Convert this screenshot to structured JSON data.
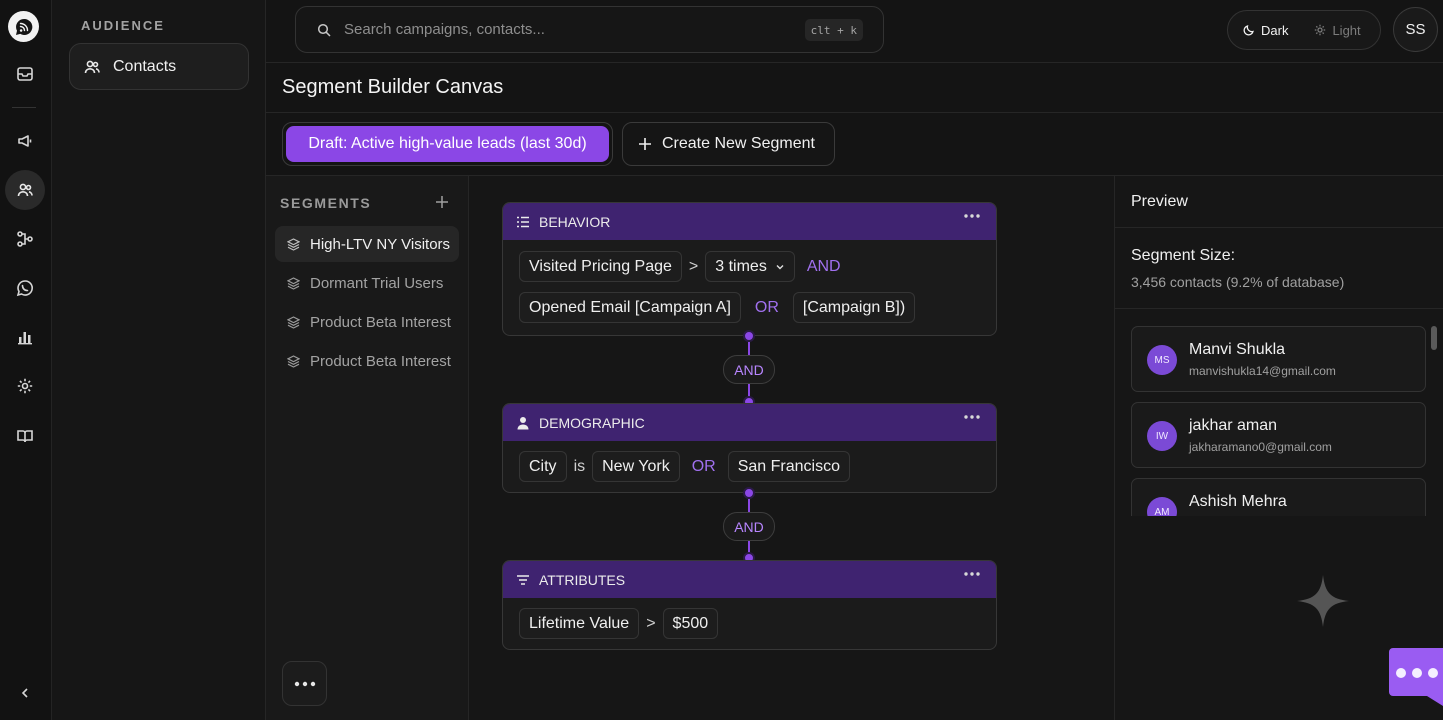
{
  "app": {
    "brand_icon": "chat-bubble-logo-icon",
    "accent": "#8b47e6",
    "card_header_color": "#3f2370"
  },
  "rail": {
    "icons": [
      "mail-icon",
      "megaphone-icon",
      "users-icon",
      "flow-icon",
      "whatsapp-icon",
      "chart-icon",
      "settings-icon",
      "book-icon",
      "collapse-chevron-icon"
    ],
    "active": "users-icon"
  },
  "subnav": {
    "heading": "AUDIENCE",
    "items": [
      {
        "label": "Contacts",
        "icon": "users-icon"
      }
    ]
  },
  "search": {
    "placeholder": "Search campaigns, contacts...",
    "shortcut": "clt + k"
  },
  "theme": {
    "dark_label": "Dark",
    "light_label": "Light",
    "selected": "Dark"
  },
  "user": {
    "initials": "SS"
  },
  "page": {
    "title": "Segment Builder Canvas"
  },
  "tabs": {
    "draft_label": "Draft: Active high-value leads (last 30d)",
    "create_label": "Create New Segment"
  },
  "segments": {
    "heading": "SEGMENTS",
    "items": [
      {
        "label": "High-LTV NY Visitors",
        "active": true
      },
      {
        "label": "Dormant Trial Users",
        "active": false
      },
      {
        "label": "Product Beta Interest",
        "active": false
      },
      {
        "label": "Product Beta Interest",
        "active": false
      }
    ]
  },
  "canvas": {
    "behavior": {
      "title": "BEHAVIOR",
      "row1": {
        "event": "Visited Pricing Page",
        "op": ">",
        "count": "3 times",
        "logic": "AND"
      },
      "row2": {
        "event": "Opened Email [Campaign A]",
        "logic": "OR",
        "alt": "[Campaign B])"
      }
    },
    "connector1": "AND",
    "demographic": {
      "title": "DEMOGRAPHIC",
      "row": {
        "field": "City",
        "op": "is",
        "value": "New York",
        "logic": "OR",
        "alt": "San Francisco"
      }
    },
    "connector2": "AND",
    "attributes": {
      "title": "ATTRIBUTES",
      "row": {
        "field": "Lifetime Value",
        "op": ">",
        "value": "$500"
      }
    }
  },
  "preview": {
    "title": "Preview",
    "size_label": "Segment Size:",
    "size_value": "3,456 contacts (9.2% of database)",
    "contacts": [
      {
        "initials": "MS",
        "name": "Manvi Shukla",
        "email": "manvishukla14@gmail.com"
      },
      {
        "initials": "IW",
        "name": "jakhar aman",
        "email": "jakharamano0@gmail.com"
      },
      {
        "initials": "AM",
        "name": "Ashish Mehra",
        "email": ""
      }
    ]
  }
}
